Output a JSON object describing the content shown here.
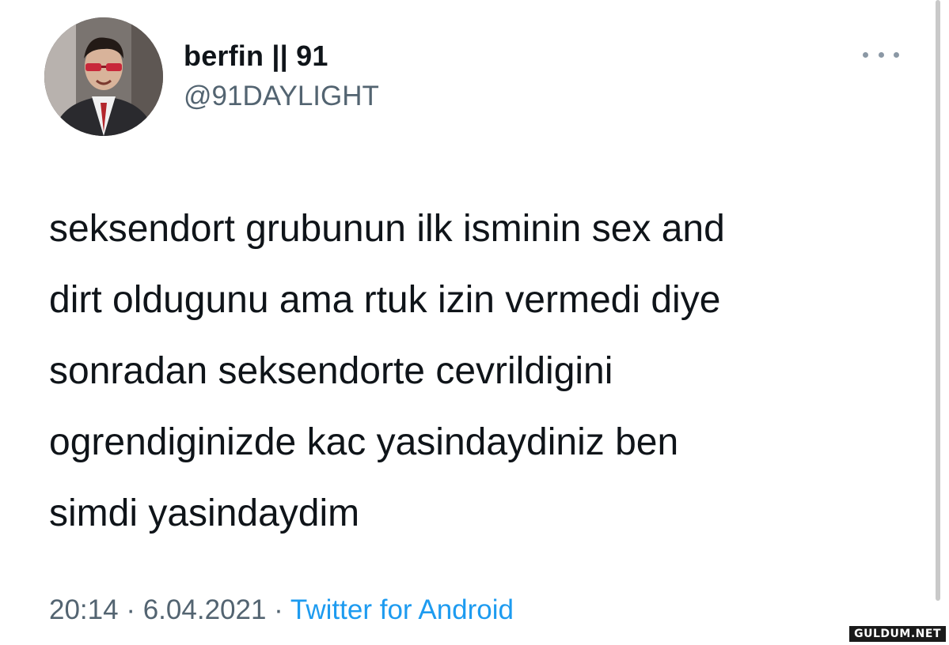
{
  "tweet": {
    "display_name": "berfin || 91",
    "handle": "@91DAYLIGHT",
    "text": "seksendort grubunun ilk isminin sex and\ndirt oldugunu ama rtuk izin vermedi diye\nsonradan seksendorte cevrildigini\nogrendiginizde kac yasindaydiniz ben\nsimdi yasindaydim",
    "time": "20:14",
    "separator": "·",
    "date": "6.04.2021",
    "source": "Twitter for Android"
  },
  "icons": {
    "more": "more-horizontal-icon",
    "avatar": "avatar"
  },
  "watermark": "GULDUM.NET",
  "colors": {
    "text": "#0f1419",
    "secondary": "#536471",
    "link": "#1d9bf0",
    "background": "#ffffff"
  }
}
